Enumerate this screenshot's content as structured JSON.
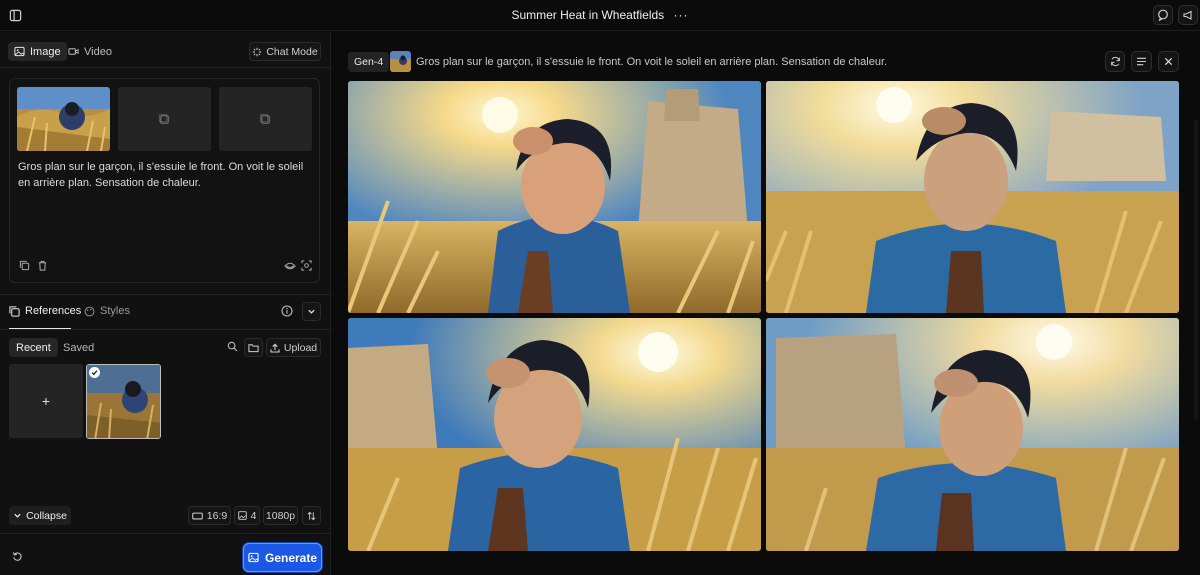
{
  "header": {
    "title": "Summer Heat in Wheatfields",
    "more_icon": "ellipsis-icon",
    "left_icon": "sidebar-toggle-icon",
    "right_icons": [
      "feedback-icon",
      "announcement-icon"
    ]
  },
  "mode_tabs": {
    "image_label": "Image",
    "video_label": "Video",
    "chat_mode_label": "Chat Mode",
    "active": "Image"
  },
  "prompt_box": {
    "text": "Gros plan sur le garçon, il s'essuie le front. On voit le soleil en arrière plan. Sensation de chaleur.",
    "actions": [
      "copy-icon",
      "trash-icon",
      "eye-icon",
      "magic-scan-icon"
    ]
  },
  "references": {
    "tab_references": "References",
    "tab_styles": "Styles",
    "chip_recent": "Recent",
    "chip_saved": "Saved",
    "upload_label": "Upload",
    "add_label": "+"
  },
  "footer": {
    "collapse_label": "Collapse",
    "aspect_ratio": "16:9",
    "count": "4",
    "resolution": "1080p",
    "generate_label": "Generate"
  },
  "generation": {
    "model_badge": "Gen-4",
    "prompt": "Gros plan sur le garçon, il s'essuie le front. On voit le soleil en arrière plan. Sensation de chaleur.",
    "toolbar_icons": [
      "refresh-icon",
      "list-icon",
      "close-icon"
    ],
    "results": [
      "result-image-1",
      "result-image-2",
      "result-image-3",
      "result-image-4"
    ]
  },
  "colors": {
    "accent": "#1c58e6",
    "background": "#0b0b0b",
    "panel": "#111111"
  }
}
